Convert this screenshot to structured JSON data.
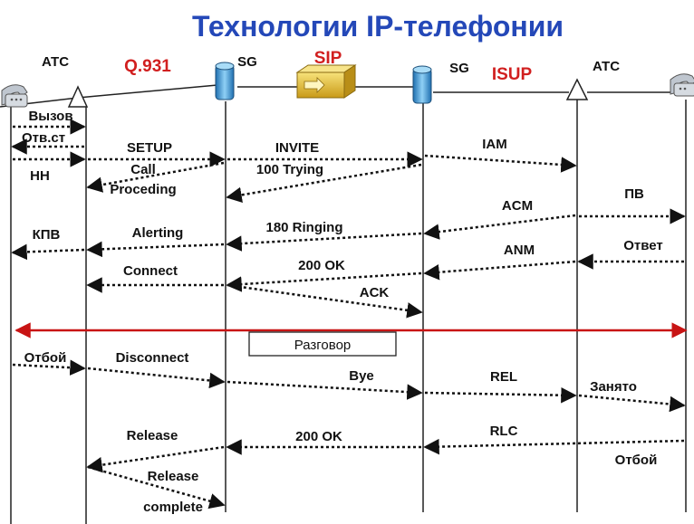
{
  "title": "Технологии IP-телефонии",
  "header": {
    "atc_left": "АТС",
    "atc_right": "АТС",
    "sg_left": "SG",
    "sg_right": "SG",
    "q931": "Q.931",
    "sip": "SIP",
    "isup": "ISUP"
  },
  "messages": {
    "vyzov": "Вызов",
    "otv_st": "Отв.ст",
    "nn": "НН",
    "setup": "SETUP",
    "call": "Call",
    "proceding": "Proceding",
    "invite": "INVITE",
    "trying": "100 Trying",
    "iam": "IAM",
    "acm": "ACM",
    "pv": "ПВ",
    "kpv": "КПВ",
    "alerting": "Alerting",
    "ringing": "180 Ringing",
    "anm": "ANM",
    "otvet": "Ответ",
    "connect": "Connect",
    "ok200_a": "200 OK",
    "ack": "ACK",
    "razgovor": "Разговор",
    "otboy_left": "Отбой",
    "disconnect": "Disconnect",
    "bye": "Bye",
    "rel": "REL",
    "zanyato": "Занято",
    "release": "Release",
    "ok200_b": "200 OK",
    "rlc": "RLC",
    "otboy_right": "Отбой",
    "release2": "Release",
    "complete": "complete"
  },
  "icons": {
    "phone": "telephone-icon",
    "gateway": "signaling-gateway-icon",
    "sip_server": "sip-server-icon",
    "atc": "atc-triangle-icon"
  },
  "colors": {
    "title": "#2448b8",
    "protocol": "#d11f1f",
    "talk_line": "#c81414",
    "gateway": "#3a8fd0",
    "sip_box": "#e8c43a"
  }
}
